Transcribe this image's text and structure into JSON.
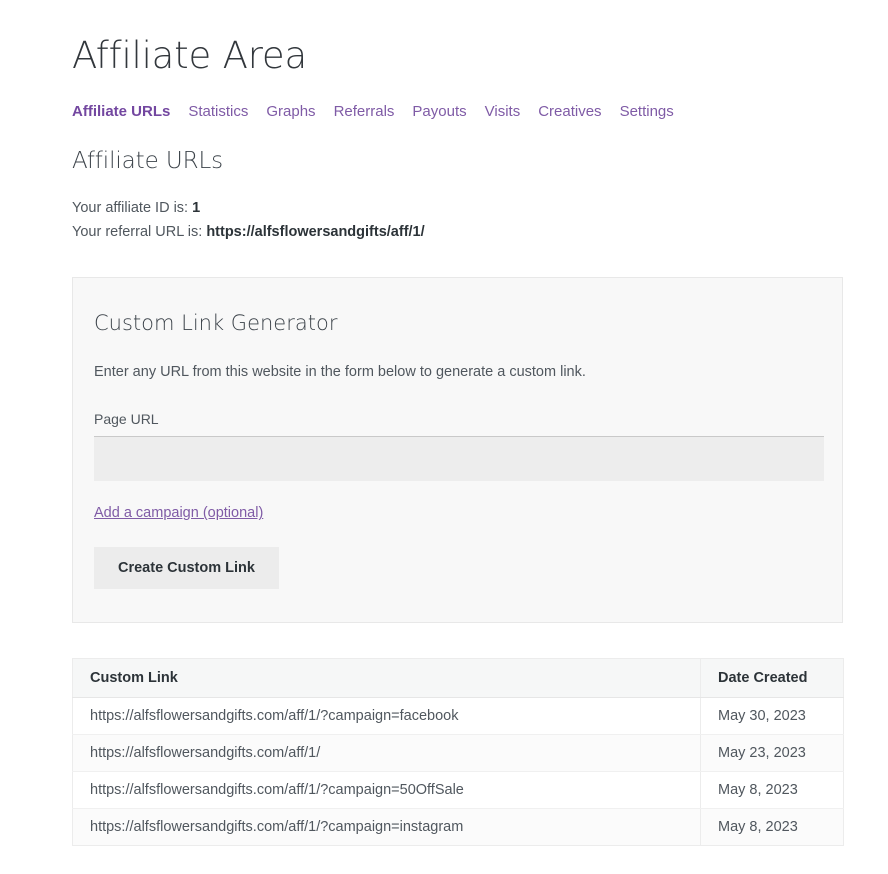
{
  "page": {
    "title": "Affiliate Area"
  },
  "nav": {
    "tabs": [
      {
        "label": "Affiliate URLs",
        "active": true
      },
      {
        "label": "Statistics",
        "active": false
      },
      {
        "label": "Graphs",
        "active": false
      },
      {
        "label": "Referrals",
        "active": false
      },
      {
        "label": "Payouts",
        "active": false
      },
      {
        "label": "Visits",
        "active": false
      },
      {
        "label": "Creatives",
        "active": false
      },
      {
        "label": "Settings",
        "active": false
      }
    ]
  },
  "section": {
    "heading": "Affiliate URLs",
    "affiliate_id_label": "Your affiliate ID is:",
    "affiliate_id_value": "1",
    "referral_url_label": "Your referral URL is:",
    "referral_url_value": "https://alfsflowersandgifts/aff/1/"
  },
  "generator": {
    "title": "Custom Link Generator",
    "description": "Enter any URL from this website in the form below to generate a custom link.",
    "page_url_label": "Page URL",
    "page_url_value": "",
    "page_url_placeholder": "",
    "campaign_link_label": "Add a campaign (optional)",
    "create_button_label": "Create Custom Link"
  },
  "table": {
    "columns": [
      "Custom Link",
      "Date Created"
    ],
    "rows": [
      {
        "link": "https://alfsflowersandgifts.com/aff/1/?campaign=facebook",
        "date": "May 30, 2023"
      },
      {
        "link": "https://alfsflowersandgifts.com/aff/1/",
        "date": "May 23, 2023"
      },
      {
        "link": "https://alfsflowersandgifts.com/aff/1/?campaign=50OffSale",
        "date": "May 8, 2023"
      },
      {
        "link": "https://alfsflowersandgifts.com/aff/1/?campaign=instagram",
        "date": "May 8, 2023"
      }
    ]
  },
  "colors": {
    "accent_purple": "#7f5ba6",
    "active_tab": "#7347a0",
    "panel_bg": "#f8f8f8",
    "input_bg": "#ededed",
    "button_bg": "#ececec",
    "table_header_bg": "#f6f7f7"
  }
}
